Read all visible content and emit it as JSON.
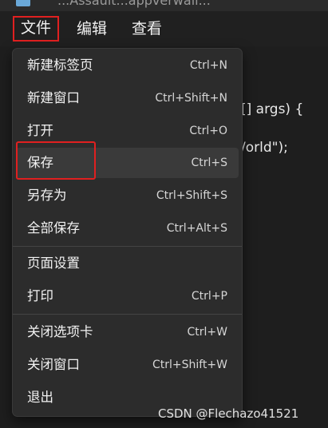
{
  "titlebar": {
    "text": "...Assault...appverwall..."
  },
  "menubar": {
    "file": "文件",
    "edit": "编辑",
    "view": "查看"
  },
  "editor": {
    "line1": "[] args) {",
    "line2": "/orld\");"
  },
  "dropdown": {
    "items": [
      {
        "label": "新建标签页",
        "shortcut": "Ctrl+N"
      },
      {
        "label": "新建窗口",
        "shortcut": "Ctrl+Shift+N"
      },
      {
        "label": "打开",
        "shortcut": "Ctrl+O"
      },
      {
        "label": "保存",
        "shortcut": "Ctrl+S"
      },
      {
        "label": "另存为",
        "shortcut": "Ctrl+Shift+S"
      },
      {
        "label": "全部保存",
        "shortcut": "Ctrl+Alt+S"
      },
      {
        "label": "页面设置",
        "shortcut": ""
      },
      {
        "label": "打印",
        "shortcut": "Ctrl+P"
      },
      {
        "label": "关闭选项卡",
        "shortcut": "Ctrl+W"
      },
      {
        "label": "关闭窗口",
        "shortcut": "Ctrl+Shift+W"
      },
      {
        "label": "退出",
        "shortcut": ""
      }
    ]
  },
  "watermark": "CSDN @Flechazo41521",
  "colors": {
    "highlight_box": "#e02020",
    "menu_bg": "#2c2c2c",
    "hover_bg": "#3a3a3a"
  }
}
